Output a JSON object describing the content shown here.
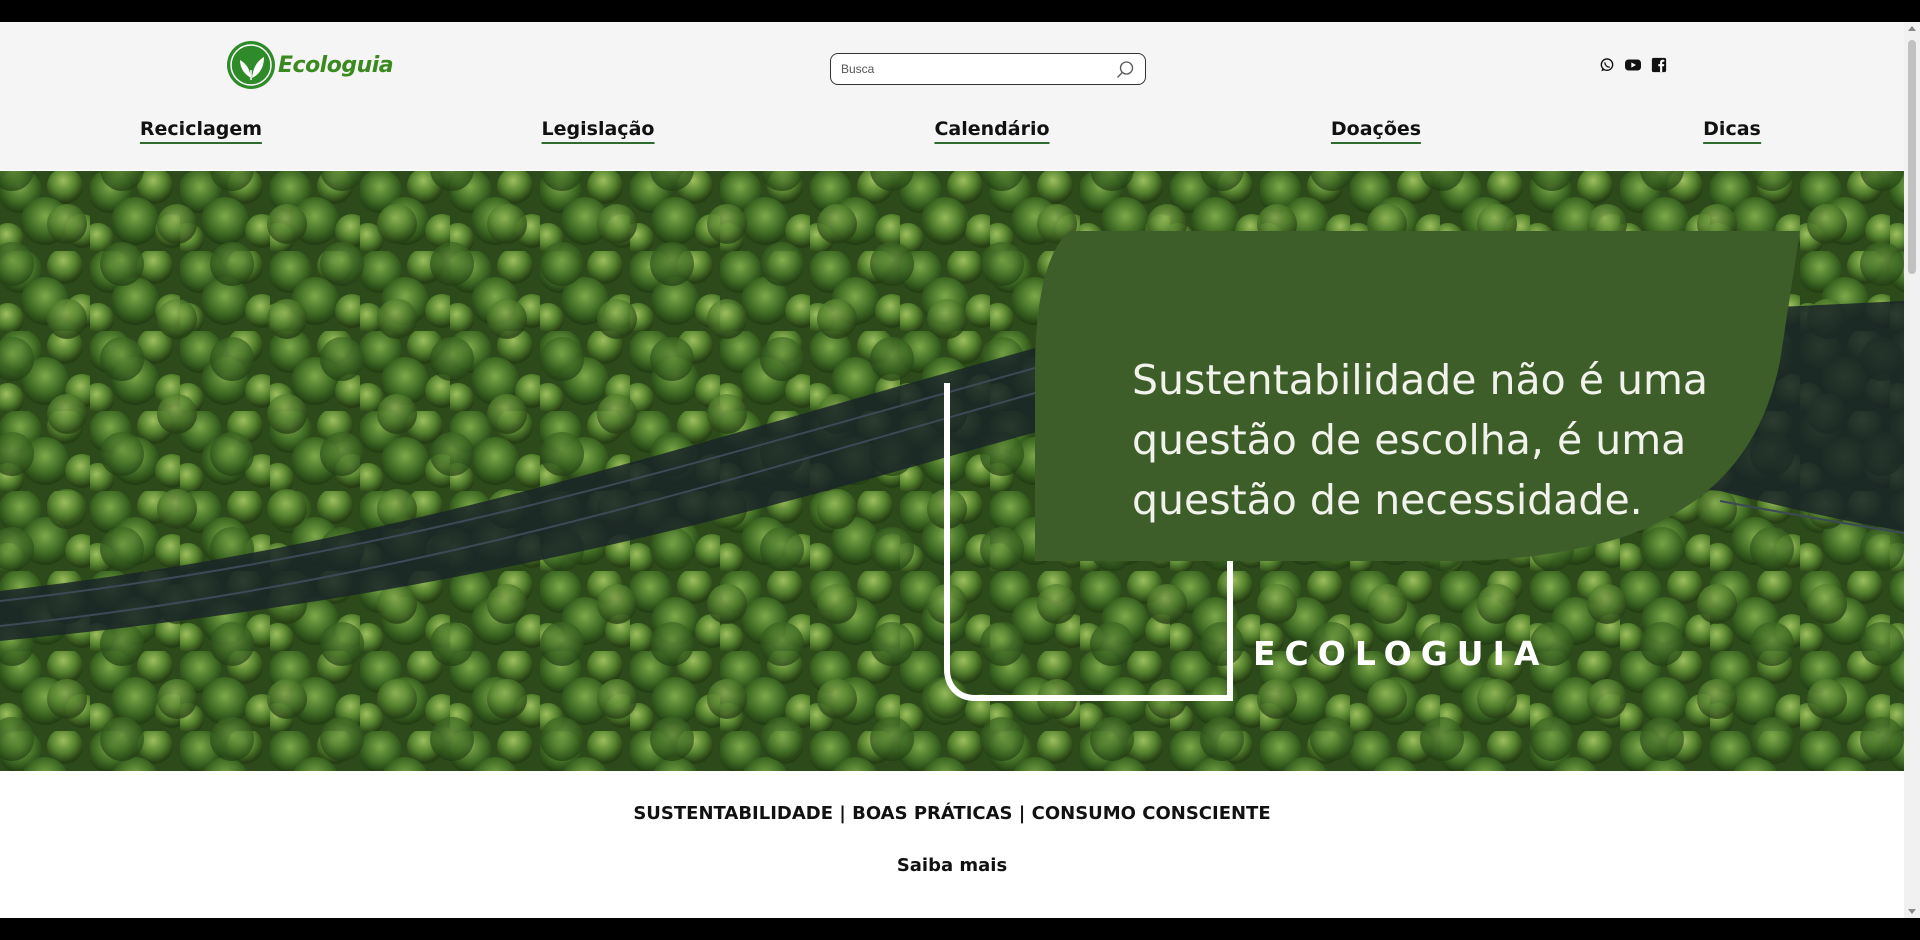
{
  "header": {
    "logo_text": "Ecologuia",
    "search_placeholder": "Busca",
    "social_icons": [
      "whatsapp-icon",
      "youtube-icon",
      "facebook-icon"
    ]
  },
  "nav": {
    "items": [
      {
        "label": "Reciclagem"
      },
      {
        "label": "Legislação"
      },
      {
        "label": "Calendário"
      },
      {
        "label": "Doações"
      },
      {
        "label": "Dicas"
      }
    ]
  },
  "hero": {
    "quote_lines": [
      "Sustentabilidade não é uma",
      "questão de escolha, é uma",
      "questão de necessidade."
    ],
    "brand": "ECOLOGUIA"
  },
  "tagline": "SUSTENTABILIDADE | BOAS PRÁTICAS | CONSUMO CONSCIENTE",
  "more_label": "Saiba mais",
  "colors": {
    "brand_green": "#3a8a1f",
    "leaf_panel": "#3d5e29",
    "header_bg": "#f5f5f5"
  }
}
